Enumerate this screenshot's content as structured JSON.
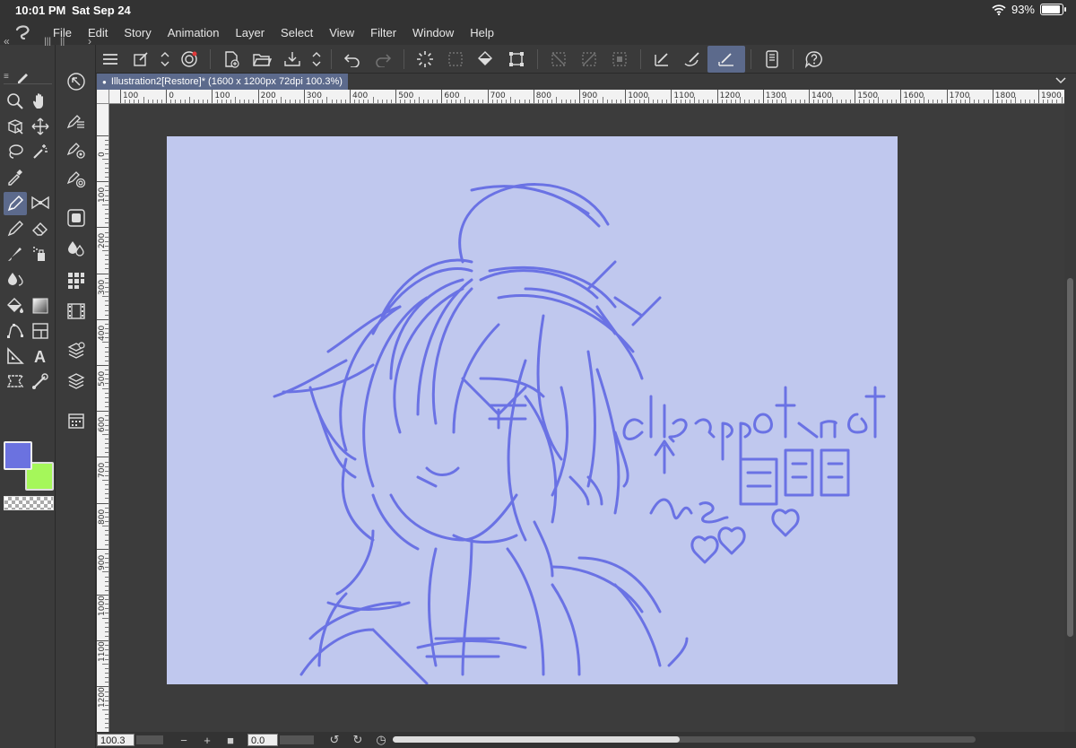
{
  "status": {
    "time": "10:01 PM",
    "date": "Sat Sep 24",
    "battery": "93%",
    "battery_level": 0.93
  },
  "menu": [
    "File",
    "Edit",
    "Story",
    "Animation",
    "Layer",
    "Select",
    "View",
    "Filter",
    "Window",
    "Help"
  ],
  "document": {
    "tab_title": "Illustration2[Restore]* (1600 x 1200px 72dpi 100.3%)"
  },
  "ruler": {
    "h_labels": [
      "100",
      "0",
      "100",
      "200",
      "300",
      "400",
      "500",
      "600",
      "700",
      "800",
      "900",
      "1000",
      "1100",
      "1200",
      "1300",
      "1400",
      "1500",
      "1600",
      "1700",
      "1800",
      "1900"
    ],
    "v_labels": [
      "0",
      "100",
      "200",
      "300",
      "400",
      "500",
      "600",
      "700",
      "800",
      "900",
      "1000",
      "1100",
      "1200"
    ]
  },
  "bottom": {
    "zoom": "100.3",
    "angle": "0.0",
    "minus": "−",
    "plus": "+"
  },
  "colors": {
    "main": "#6b72e0",
    "sub": "#a5f75a",
    "canvas": "#c0c8ee",
    "stroke": "#6a72e4",
    "accent": "#5c6a8c"
  }
}
